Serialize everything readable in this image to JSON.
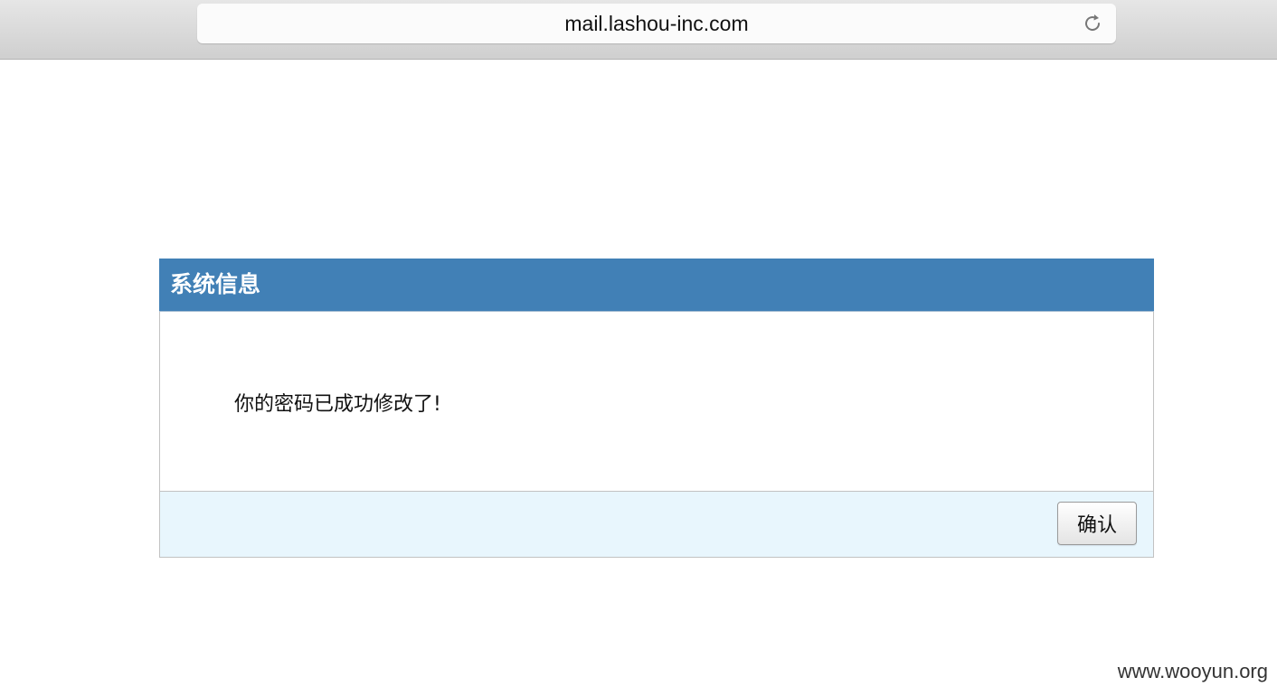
{
  "browser": {
    "url": "mail.lashou-inc.com",
    "reload_icon": "reload-icon"
  },
  "dialog": {
    "title": "系统信息",
    "message": "你的密码已成功修改了!",
    "confirm_label": "确认",
    "header_color": "#4180b6",
    "footer_color": "#e8f6fd"
  },
  "watermark": "www.wooyun.org"
}
